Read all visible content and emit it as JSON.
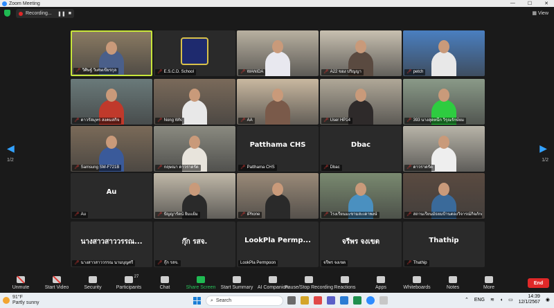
{
  "window": {
    "title": "Zoom Meeting",
    "controls": [
      "—",
      "☐",
      "✕"
    ]
  },
  "topbar": {
    "recording_label": "Recording...",
    "view_label": "View"
  },
  "pagination": {
    "left": "1/2",
    "right": "1/2"
  },
  "tiles": [
    {
      "name": "วิศิษฐ์ วิเศษเขียรกุล",
      "kind": "video",
      "active": true,
      "bg": "#8a7a62",
      "shirt": "#4a5f8a"
    },
    {
      "name": "E.S.C.D. School",
      "kind": "logo",
      "bg": "#2a2a2a"
    },
    {
      "name": "WANIDA",
      "kind": "video",
      "bg": "#b8b0a0",
      "shirt": "#e8e8ef"
    },
    {
      "name": "A22 ของ ปริญญา",
      "kind": "video",
      "bg": "#c8c0b0",
      "shirt": "#5a4a40"
    },
    {
      "name": "petch",
      "kind": "video",
      "bg": "#4a7fc0",
      "shirt": "#e8e8e8"
    },
    {
      "name": "ดาวรัสมุทร สงคมสกิจ",
      "kind": "video",
      "bg": "#6a7a7a",
      "shirt": "#c0392b"
    },
    {
      "name": "Nong WN",
      "kind": "video",
      "bg": "#7a6a5a",
      "shirt": "#e8e8e8"
    },
    {
      "name": "AA",
      "kind": "video",
      "bg": "#c9b8a0",
      "shirt": "#7a5a4a"
    },
    {
      "name": "User HP14",
      "kind": "video",
      "bg": "#b0a898",
      "shirt": "#2e2a2a"
    },
    {
      "name": "393 นางสุดหนึก วิรุณรักษ์ยม",
      "kind": "video",
      "bg": "#8a9a88",
      "shirt": "#2ecc40"
    },
    {
      "name": "Samsung SM-F721B",
      "kind": "video",
      "bg": "#7a6a58",
      "shirt": "#3a5a9a"
    },
    {
      "name": "กฤษณา ดาวราดรัต",
      "kind": "video",
      "bg": "#8a8a80",
      "shirt": "#e8e4dc"
    },
    {
      "name": "Patthama CHS",
      "kind": "text",
      "big": "Patthama CHS"
    },
    {
      "name": "Dbac",
      "kind": "text",
      "big": "Dbac"
    },
    {
      "name": "ดาวราดรัต",
      "kind": "video",
      "bg": "#b8b4a8",
      "shirt": "#eeeeee"
    },
    {
      "name": "Au",
      "kind": "text",
      "big": "Au"
    },
    {
      "name": "ปัญญารัตน์ ยิ้มแย้ม",
      "kind": "video",
      "bg": "#c0b8a8",
      "shirt": "#2a2a2a"
    },
    {
      "name": "iPhone",
      "kind": "video",
      "bg": "#9a8a78",
      "shirt": "#2a2a2a"
    },
    {
      "name": "โรงเรียนมะขามสะเดาพงษ์",
      "kind": "video",
      "bg": "#7a8a70",
      "shirt": "#4a90c0"
    },
    {
      "name": "สถานเรียนมัธยมป้านตองวิจารณ์กิจภักดี",
      "kind": "video",
      "bg": "#5a4a40",
      "shirt": "#3a6a9a"
    },
    {
      "name": "นางสาวสาววรรณ นามบุญศรี",
      "kind": "text",
      "big": "นางสาวสาววรรณ..."
    },
    {
      "name": "กุ๊ก รสจ.",
      "kind": "text",
      "big": "กุ๊ก รสจ."
    },
    {
      "name": "LookPla Permpoon",
      "kind": "text",
      "big": "LookPla Permp...",
      "nomic": true
    },
    {
      "name": "จรีพร จงเขต",
      "kind": "text",
      "big": "จรีพร จงเขต",
      "nomic": true
    },
    {
      "name": "Thathip",
      "kind": "text",
      "big": "Thathip"
    }
  ],
  "toolbar": [
    {
      "label": "Unmute",
      "muted": true
    },
    {
      "label": "Start Video",
      "muted": true
    },
    {
      "label": "Security"
    },
    {
      "label": "Participants",
      "count": "27"
    },
    {
      "label": "Chat"
    },
    {
      "label": "Share Screen",
      "green": true
    },
    {
      "label": "Start Summary"
    },
    {
      "label": "AI Companion"
    },
    {
      "label": "Pause/Stop Recording"
    },
    {
      "label": "Reactions"
    },
    {
      "label": "Apps"
    },
    {
      "label": "Whiteboards"
    },
    {
      "label": "Notes"
    },
    {
      "label": "More"
    }
  ],
  "end_label": "End",
  "taskbar": {
    "temp": "91°F",
    "condition": "Partly sunny",
    "search_placeholder": "Search",
    "lang": "ENG",
    "time": "14:39",
    "date": "12/1/2567"
  }
}
